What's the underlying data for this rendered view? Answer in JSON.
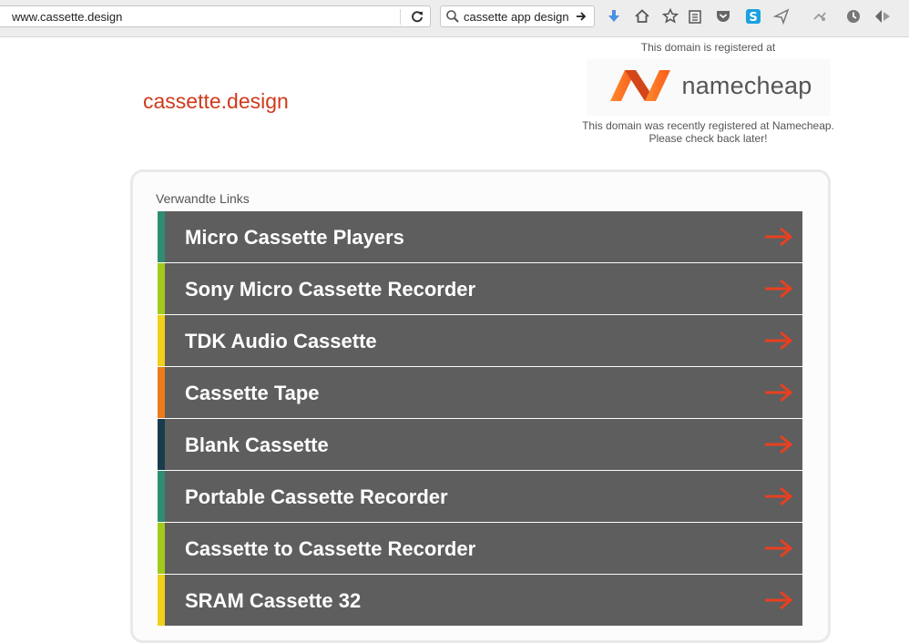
{
  "browser": {
    "url": "www.cassette.design",
    "search_query": "cassette app design",
    "toolbar_icons": [
      "download-icon",
      "home-icon",
      "bookmark-star-icon",
      "reading-list-icon",
      "pocket-icon",
      "skype-icon",
      "send-icon",
      "extension-icon",
      "history-icon",
      "menu-icon"
    ],
    "accent_colors": {
      "download": "#4a90e2",
      "skype": "#1aa1e1"
    }
  },
  "page": {
    "site_title": "cassette.design",
    "site_title_color": "#cf3a1b",
    "registrar": {
      "intro": "This domain is registered at",
      "logo_text": "namecheap",
      "logo_color": "#ff6a2b",
      "message_line1": "This domain was recently registered at Namecheap.",
      "message_line2": "Please check back later!"
    },
    "related_links": {
      "heading": "Verwandte Links",
      "items": [
        {
          "label": "Micro Cassette Players",
          "accent": "#2f8c73"
        },
        {
          "label": "Sony Micro Cassette Recorder",
          "accent": "#a3c91b"
        },
        {
          "label": "TDK Audio Cassette",
          "accent": "#f0d019"
        },
        {
          "label": "Cassette Tape",
          "accent": "#ee7a1a"
        },
        {
          "label": "Blank Cassette",
          "accent": "#173c4b"
        },
        {
          "label": "Portable Cassette Recorder",
          "accent": "#2f8c73"
        },
        {
          "label": "Cassette to Cassette Recorder",
          "accent": "#a3c91b"
        },
        {
          "label": "SRAM Cassette 32",
          "accent": "#f0d019"
        }
      ],
      "arrow_color": "#e8401f"
    }
  }
}
